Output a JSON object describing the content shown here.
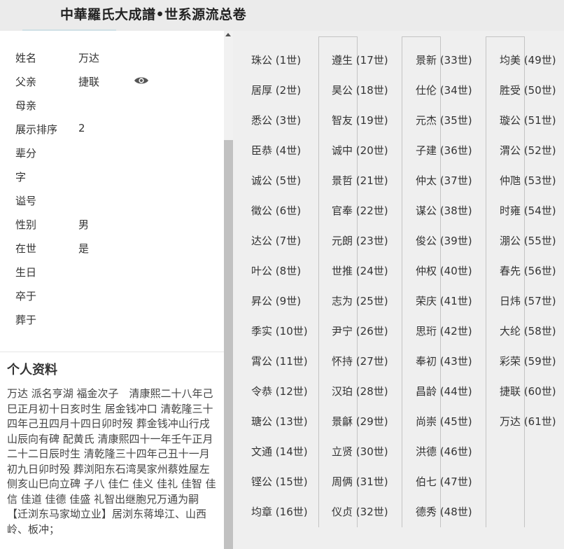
{
  "header": {
    "title": "中華羅氏大成譜•世系源流总卷"
  },
  "profile": {
    "fields": [
      {
        "label": "姓名",
        "value": "万达"
      },
      {
        "label": "父亲",
        "value": "捷联"
      },
      {
        "label": "母亲",
        "value": ""
      },
      {
        "label": "展示排序",
        "value": "2"
      },
      {
        "label": "辈分",
        "value": ""
      },
      {
        "label": "字",
        "value": ""
      },
      {
        "label": "谥号",
        "value": ""
      },
      {
        "label": "性别",
        "value": "男"
      },
      {
        "label": "在世",
        "value": "是"
      },
      {
        "label": "生日",
        "value": ""
      },
      {
        "label": "卒于",
        "value": ""
      },
      {
        "label": "葬于",
        "value": ""
      }
    ],
    "father_view_icon": "eye-icon"
  },
  "bio": {
    "title": "个人资料",
    "text": "万达 派名亨湖 福金次子　清康熙二十八年己巳正月初十日亥时生 居金钱冲口 清乾隆三十四年己丑四月十四日卯时歿 葬金钱冲山行戌山辰向有碑 配黄氏 清康熙四十一年壬午正月二十二日辰时生 清乾隆三十四年己丑十一月初九日卯时殁 葬浏阳东石湾昊家州蔡姓屋左侧亥山巳向立碑 子八 佳仁 佳义 佳礼 佳智 佳信 佳道 佳德 佳盛 礼智出继胞兄万通为嗣\n【迁浏东马家坳立业】居浏东蒋埠江、山西岭、板冲；"
  },
  "generations": [
    [
      {
        "name": "珠公",
        "gen": "(1世)"
      },
      {
        "name": "居厚",
        "gen": "(2世)"
      },
      {
        "name": "悉公",
        "gen": "(3世)"
      },
      {
        "name": "臣恭",
        "gen": "(4世)"
      },
      {
        "name": "诚公",
        "gen": "(5世)"
      },
      {
        "name": "徵公",
        "gen": "(6世)"
      },
      {
        "name": "达公",
        "gen": "(7世)"
      },
      {
        "name": "叶公",
        "gen": "(8世)"
      },
      {
        "name": "昇公",
        "gen": "(9世)"
      },
      {
        "name": "季实",
        "gen": "(10世)"
      },
      {
        "name": "霄公",
        "gen": "(11世)"
      },
      {
        "name": "令恭",
        "gen": "(12世)"
      },
      {
        "name": "瑭公",
        "gen": "(13世)"
      },
      {
        "name": "文通",
        "gen": "(14世)"
      },
      {
        "name": "铿公",
        "gen": "(15世)"
      },
      {
        "name": "均章",
        "gen": "(16世)"
      }
    ],
    [
      {
        "name": "遵生",
        "gen": "(17世)"
      },
      {
        "name": "昊公",
        "gen": "(18世)"
      },
      {
        "name": "智友",
        "gen": "(19世)"
      },
      {
        "name": "诚中",
        "gen": "(20世)"
      },
      {
        "name": "景哲",
        "gen": "(21世)"
      },
      {
        "name": "官奉",
        "gen": "(22世)"
      },
      {
        "name": "元朗",
        "gen": "(23世)"
      },
      {
        "name": "世推",
        "gen": "(24世)"
      },
      {
        "name": "志为",
        "gen": "(25世)"
      },
      {
        "name": "尹宁",
        "gen": "(26世)"
      },
      {
        "name": "怀持",
        "gen": "(27世)"
      },
      {
        "name": "汉珀",
        "gen": "(28世)"
      },
      {
        "name": "景龢",
        "gen": "(29世)"
      },
      {
        "name": "立贤",
        "gen": "(30世)"
      },
      {
        "name": "周俩",
        "gen": "(31世)"
      },
      {
        "name": "仪贞",
        "gen": "(32世)"
      }
    ],
    [
      {
        "name": "景新",
        "gen": "(33世)"
      },
      {
        "name": "仕伦",
        "gen": "(34世)"
      },
      {
        "name": "元杰",
        "gen": "(35世)"
      },
      {
        "name": "子建",
        "gen": "(36世)"
      },
      {
        "name": "仲太",
        "gen": "(37世)"
      },
      {
        "name": "谋公",
        "gen": "(38世)"
      },
      {
        "name": "俊公",
        "gen": "(39世)"
      },
      {
        "name": "仲权",
        "gen": "(40世)"
      },
      {
        "name": "荣庆",
        "gen": "(41世)"
      },
      {
        "name": "思珩",
        "gen": "(42世)"
      },
      {
        "name": "奉初",
        "gen": "(43世)"
      },
      {
        "name": "昌龄",
        "gen": "(44世)"
      },
      {
        "name": "尚崇",
        "gen": "(45世)"
      },
      {
        "name": "洪德",
        "gen": "(46世)"
      },
      {
        "name": "伯七",
        "gen": "(47世)"
      },
      {
        "name": "德秀",
        "gen": "(48世)"
      }
    ],
    [
      {
        "name": "均美",
        "gen": "(49世)"
      },
      {
        "name": "胜受",
        "gen": "(50世)"
      },
      {
        "name": "璇公",
        "gen": "(51世)"
      },
      {
        "name": "渭公",
        "gen": "(52世)"
      },
      {
        "name": "仲虺",
        "gen": "(53世)"
      },
      {
        "name": "时雍",
        "gen": "(54世)"
      },
      {
        "name": "淜公",
        "gen": "(55世)"
      },
      {
        "name": "春先",
        "gen": "(56世)"
      },
      {
        "name": "日炜",
        "gen": "(57世)"
      },
      {
        "name": "大纶",
        "gen": "(58世)"
      },
      {
        "name": "彩荣",
        "gen": "(59世)"
      },
      {
        "name": "捷联",
        "gen": "(60世)"
      },
      {
        "name": "万达",
        "gen": "(61世)"
      }
    ]
  ]
}
